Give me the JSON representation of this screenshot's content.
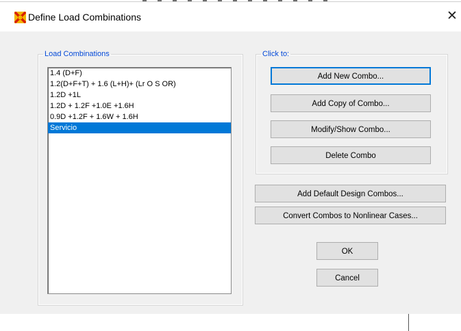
{
  "window": {
    "title": "Define Load Combinations",
    "app_icon": "sap2000-icon",
    "close_glyph": "✕"
  },
  "load_combinations": {
    "legend": "Load Combinations",
    "items": [
      "1.4 (D+F)",
      "1.2(D+F+T) + 1.6 (L+H)+ (Lr O S  OR)",
      "1.2D +1L",
      "1.2D + 1.2F +1.0E +1.6H",
      "0.9D +1.2F + 1.6W + 1.6H",
      "Servicio"
    ],
    "selected": "Servicio"
  },
  "click_to": {
    "legend": "Click to:",
    "add_new": "Add New Combo...",
    "add_copy": "Add Copy of Combo...",
    "modify_show": "Modify/Show Combo...",
    "delete": "Delete Combo"
  },
  "buttons": {
    "add_default": "Add Default Design Combos...",
    "convert": "Convert Combos to Nonlinear Cases...",
    "ok": "OK",
    "cancel": "Cancel"
  },
  "colors": {
    "accent": "#0078d7",
    "legend_text": "#0046d5",
    "dialog_bg": "#f0f0f0"
  }
}
